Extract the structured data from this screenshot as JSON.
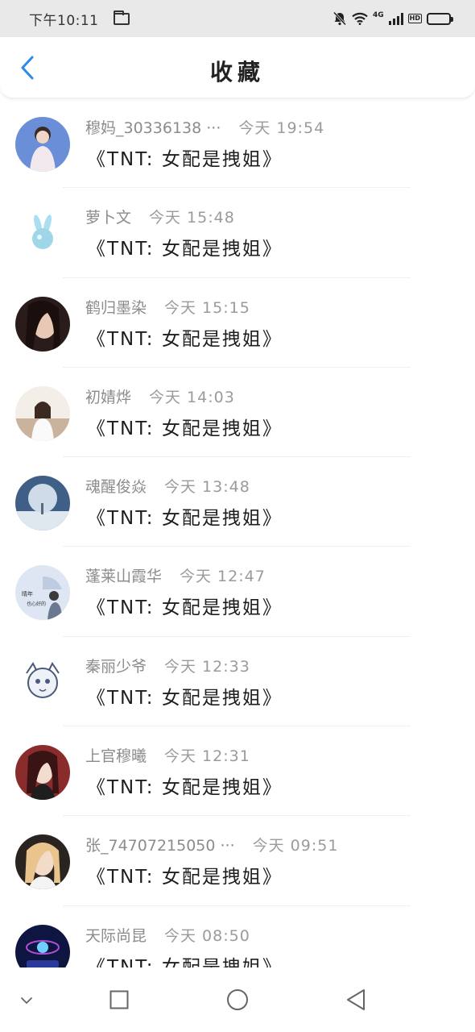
{
  "status_bar": {
    "time": "下午10:11",
    "network": "4G",
    "hd": "HD"
  },
  "header": {
    "title": "收藏"
  },
  "favorites": [
    {
      "username": "穆妈_30336138 ···",
      "time": "今天  19:54",
      "title": "《TNT:  女配是拽姐》",
      "avatar": "avatar-boy-photo",
      "colors": [
        "#6a8fd8",
        "#f2e9ee"
      ]
    },
    {
      "username": "萝卜文",
      "time": "今天  15:48",
      "title": "《TNT:  女配是拽姐》",
      "avatar": "avatar-rabbit-hand",
      "colors": [
        "#ffffff",
        "#9fd6e8"
      ]
    },
    {
      "username": "鹤归墨染",
      "time": "今天  15:15",
      "title": "《TNT:  女配是拽姐》",
      "avatar": "avatar-girl-dark",
      "colors": [
        "#2a1c1a",
        "#e8c9b5"
      ]
    },
    {
      "username": "初婧烨",
      "time": "今天  14:03",
      "title": "《TNT:  女配是拽姐》",
      "avatar": "avatar-girl-room",
      "colors": [
        "#c9b39c",
        "#f4eee8"
      ]
    },
    {
      "username": "魂醒俊焱",
      "time": "今天  13:48",
      "title": "《TNT:  女配是拽姐》",
      "avatar": "avatar-snow-tree",
      "colors": [
        "#3f5f86",
        "#dfe7ef"
      ]
    },
    {
      "username": "蓬莱山霞华",
      "time": "今天  12:47",
      "title": "《TNT:  女配是拽姐》",
      "avatar": "avatar-umbrella-girl",
      "colors": [
        "#dde6f2",
        "#6b7890"
      ],
      "avatar_text": [
        "晴年",
        "也心好的"
      ]
    },
    {
      "username": "秦丽少爷",
      "time": "今天  12:33",
      "title": "《TNT:  女配是拽姐》",
      "avatar": "avatar-sketch-cat",
      "colors": [
        "#ffffff",
        "#4b5a7a"
      ]
    },
    {
      "username": "上官穆曦",
      "time": "今天  12:31",
      "title": "《TNT:  女配是拽姐》",
      "avatar": "avatar-girl-red",
      "colors": [
        "#8a2c2c",
        "#f2dcd0"
      ]
    },
    {
      "username": "张_74707215050 ···",
      "time": "今天  09:51",
      "title": "《TNT:  女配是拽姐》",
      "avatar": "avatar-girl-blonde",
      "colors": [
        "#2a2420",
        "#e9c48c"
      ]
    },
    {
      "username": "天际尚昆",
      "time": "今天  08:50",
      "title": "《TNT:  女配是拽姐》",
      "avatar": "avatar-neon-space",
      "colors": [
        "#0d1540",
        "#b04fd6"
      ]
    }
  ],
  "nav": {
    "buttons": [
      "collapse",
      "recents",
      "home",
      "back"
    ]
  }
}
